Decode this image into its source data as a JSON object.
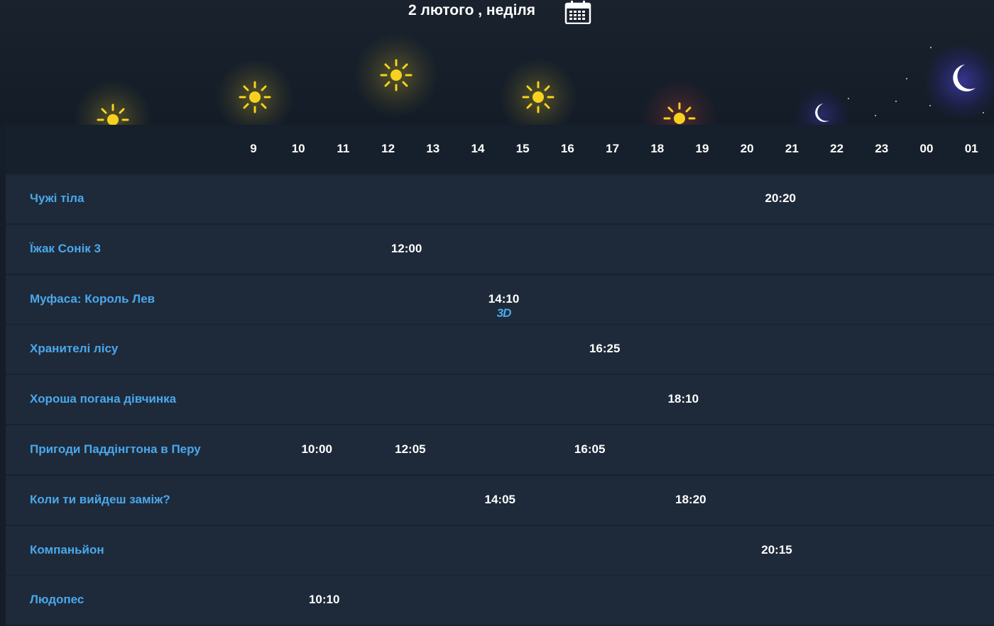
{
  "header": {
    "date_label": "2 лютого , неділя"
  },
  "icons": {
    "calendar": "calendar-icon",
    "sun": "sun-icon",
    "moon": "moon-icon"
  },
  "colors": {
    "background": "#151d28",
    "row": "#1e2a3a",
    "movie_title": "#4aa8ec",
    "sun": "#f6d21e",
    "moon": "#ffffff"
  },
  "hours": [
    "9",
    "10",
    "11",
    "12",
    "13",
    "14",
    "15",
    "16",
    "17",
    "18",
    "19",
    "20",
    "21",
    "22",
    "23",
    "00",
    "01"
  ],
  "movies": [
    {
      "title": "Чужі тіла",
      "sessions": [
        {
          "time": "20:20"
        }
      ]
    },
    {
      "title": "Їжак Сонік 3",
      "sessions": [
        {
          "time": "12:00"
        }
      ]
    },
    {
      "title": "Муфаса: Король Лев",
      "sessions": [
        {
          "time": "14:10",
          "format": "3D"
        }
      ]
    },
    {
      "title": "Хранителі лісу",
      "sessions": [
        {
          "time": "16:25"
        }
      ]
    },
    {
      "title": "Хороша погана дівчинка",
      "sessions": [
        {
          "time": "18:10"
        }
      ]
    },
    {
      "title": "Пригоди Паддінгтона в Перу",
      "sessions": [
        {
          "time": "10:00"
        },
        {
          "time": "12:05"
        },
        {
          "time": "16:05"
        }
      ]
    },
    {
      "title": "Коли ти вийдеш заміж?",
      "sessions": [
        {
          "time": "14:05"
        },
        {
          "time": "18:20"
        }
      ]
    },
    {
      "title": "Компаньйон",
      "sessions": [
        {
          "time": "20:15"
        }
      ]
    },
    {
      "title": "Людопес",
      "sessions": [
        {
          "time": "10:10"
        }
      ]
    }
  ]
}
